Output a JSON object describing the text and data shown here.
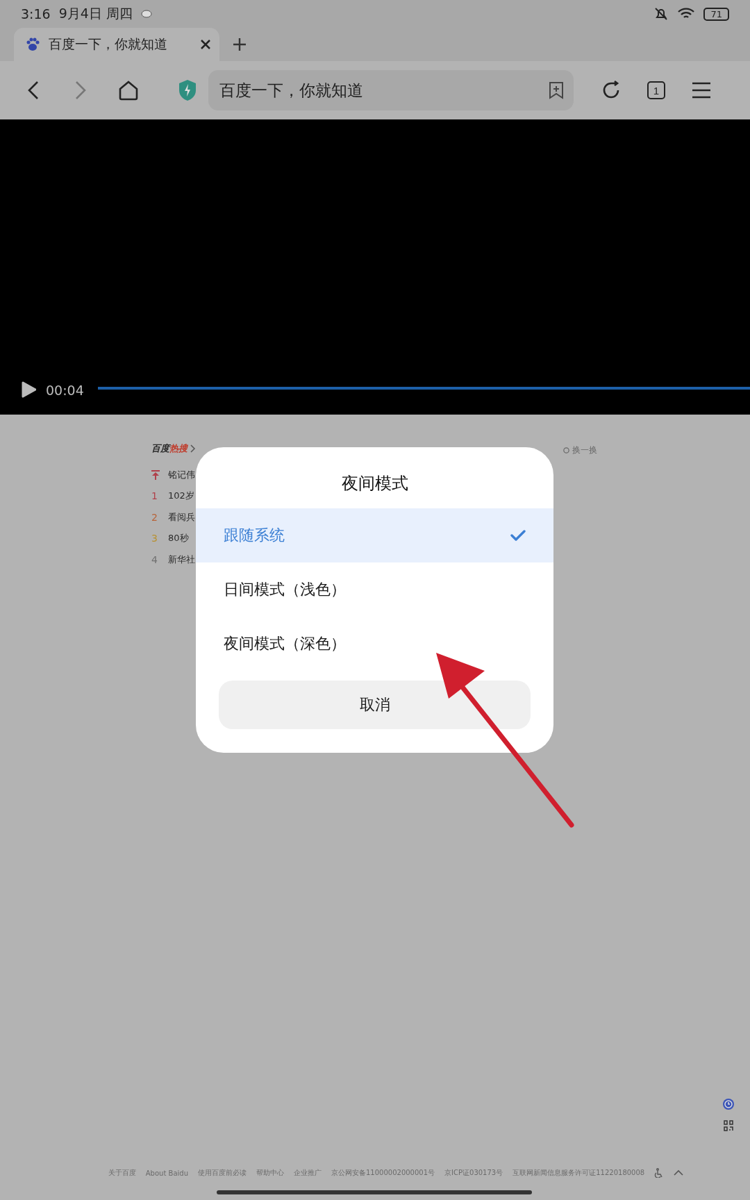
{
  "status_bar": {
    "time": "3:16",
    "date": "9月4日 周四",
    "battery": "71"
  },
  "tabs": [
    {
      "title": "百度一下，你就知道",
      "selected": true
    }
  ],
  "toolbar": {
    "address": "百度一下，你就知道",
    "tab_count": "1"
  },
  "video": {
    "time": "00:04",
    "level": 1
  },
  "hot_search": {
    "title": "百度",
    "title_accent": "热搜",
    "refresh": "换一换",
    "items": [
      {
        "kind": "pinned",
        "text": "铭记伟",
        "color": "#b0404a"
      },
      {
        "kind": "ranked",
        "rank": "1",
        "text": "102岁",
        "color": "#b0404a"
      },
      {
        "kind": "ranked",
        "rank": "2",
        "text": "看阅兵",
        "color": "#b8643a"
      },
      {
        "kind": "ranked",
        "rank": "3",
        "text": "80秒",
        "color": "#b8902e"
      },
      {
        "kind": "ranked",
        "rank": "4",
        "text": "新华社",
        "color": "#707070"
      }
    ]
  },
  "dialog": {
    "title": "夜间模式",
    "options": [
      {
        "label": "跟随系统",
        "selected": true
      },
      {
        "label": "日间模式（浅色）",
        "selected": false
      },
      {
        "label": "夜间模式（深色）",
        "selected": false
      }
    ],
    "cancel": "取消"
  },
  "footer": {
    "links": [
      "关于百度",
      "About Baidu",
      "使用百度前必读",
      "帮助中心",
      "企业推广",
      "京公网安备11000002000001号",
      "京ICP证030173号",
      "互联网新闻信息服务许可证11220180008"
    ]
  }
}
